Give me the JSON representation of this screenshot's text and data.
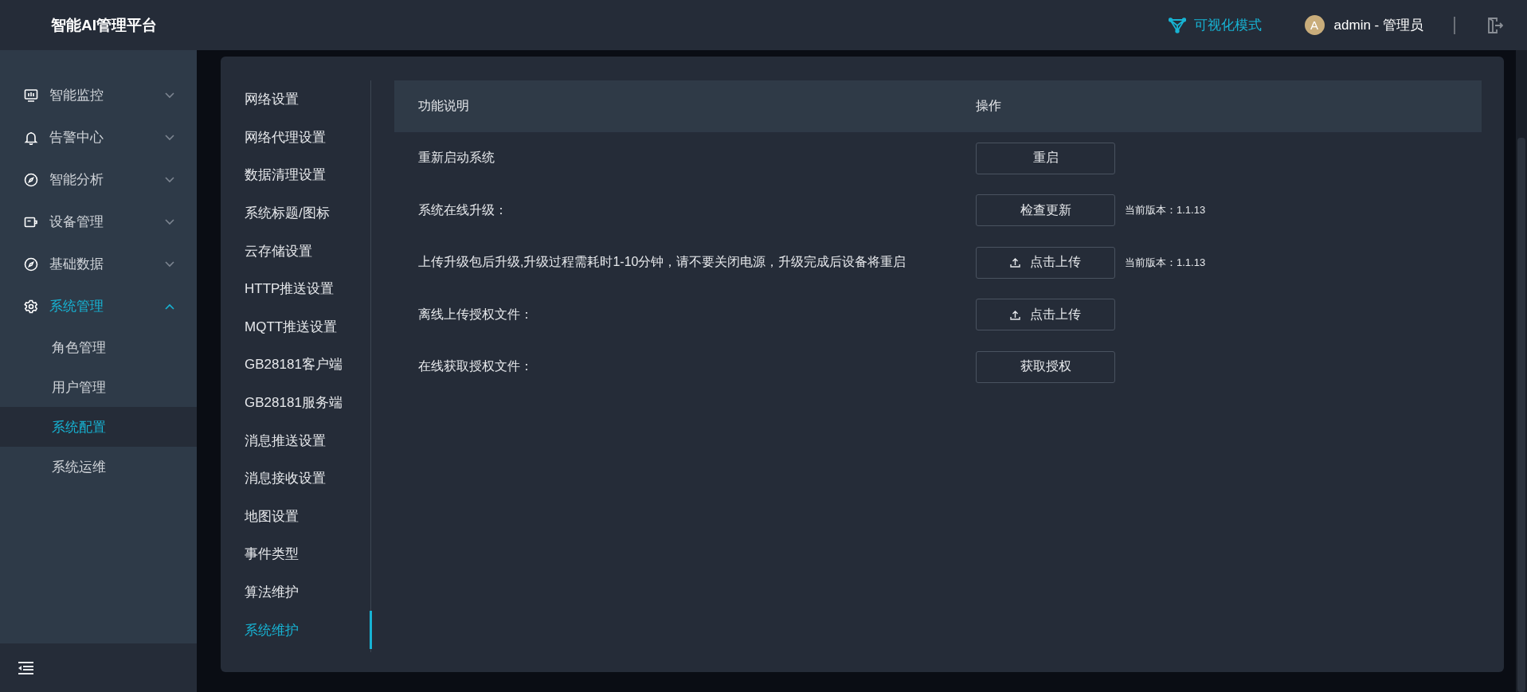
{
  "header": {
    "title": "智能AI管理平台",
    "mode_link": "可视化模式",
    "avatar_letter": "A",
    "user": "admin - 管理员"
  },
  "sidebar": {
    "items": [
      {
        "label": "智能监控",
        "kind": "monitor",
        "expanded": false
      },
      {
        "label": "告警中心",
        "kind": "bell",
        "expanded": false
      },
      {
        "label": "智能分析",
        "kind": "compass",
        "expanded": false
      },
      {
        "label": "设备管理",
        "kind": "camera",
        "expanded": false
      },
      {
        "label": "基础数据",
        "kind": "compass",
        "expanded": false
      },
      {
        "label": "系统管理",
        "kind": "gear",
        "expanded": true,
        "children": [
          {
            "label": "角色管理",
            "selected": false
          },
          {
            "label": "用户管理",
            "selected": false
          },
          {
            "label": "系统配置",
            "selected": true
          },
          {
            "label": "系统运维",
            "selected": false
          }
        ]
      }
    ]
  },
  "settings_menu": [
    {
      "label": "网络设置",
      "selected": false
    },
    {
      "label": "网络代理设置",
      "selected": false
    },
    {
      "label": "数据清理设置",
      "selected": false
    },
    {
      "label": "系统标题/图标",
      "selected": false
    },
    {
      "label": "云存储设置",
      "selected": false
    },
    {
      "label": "HTTP推送设置",
      "selected": false
    },
    {
      "label": "MQTT推送设置",
      "selected": false
    },
    {
      "label": "GB28181客户端",
      "selected": false
    },
    {
      "label": "GB28181服务端",
      "selected": false
    },
    {
      "label": "消息推送设置",
      "selected": false
    },
    {
      "label": "消息接收设置",
      "selected": false
    },
    {
      "label": "地图设置",
      "selected": false
    },
    {
      "label": "事件类型",
      "selected": false
    },
    {
      "label": "算法维护",
      "selected": false
    },
    {
      "label": "系统维护",
      "selected": true
    }
  ],
  "table": {
    "columns": [
      "功能说明",
      "操作"
    ],
    "rows": [
      {
        "description": "重新启动系统",
        "action": {
          "label": "重启",
          "kind": "plain"
        }
      },
      {
        "description": "系统在线升级：",
        "action": {
          "label": "检查更新",
          "kind": "plain"
        },
        "note": "当前版本：1.1.13"
      },
      {
        "description": "上传升级包后升级,升级过程需耗时1-10分钟，请不要关闭电源，升级完成后设备将重启",
        "action": {
          "label": "点击上传",
          "kind": "upload"
        },
        "note": "当前版本：1.1.13"
      },
      {
        "description": "离线上传授权文件：",
        "action": {
          "label": "点击上传",
          "kind": "upload"
        }
      },
      {
        "description": "在线获取授权文件：",
        "action": {
          "label": "获取授权",
          "kind": "plain"
        }
      }
    ]
  }
}
